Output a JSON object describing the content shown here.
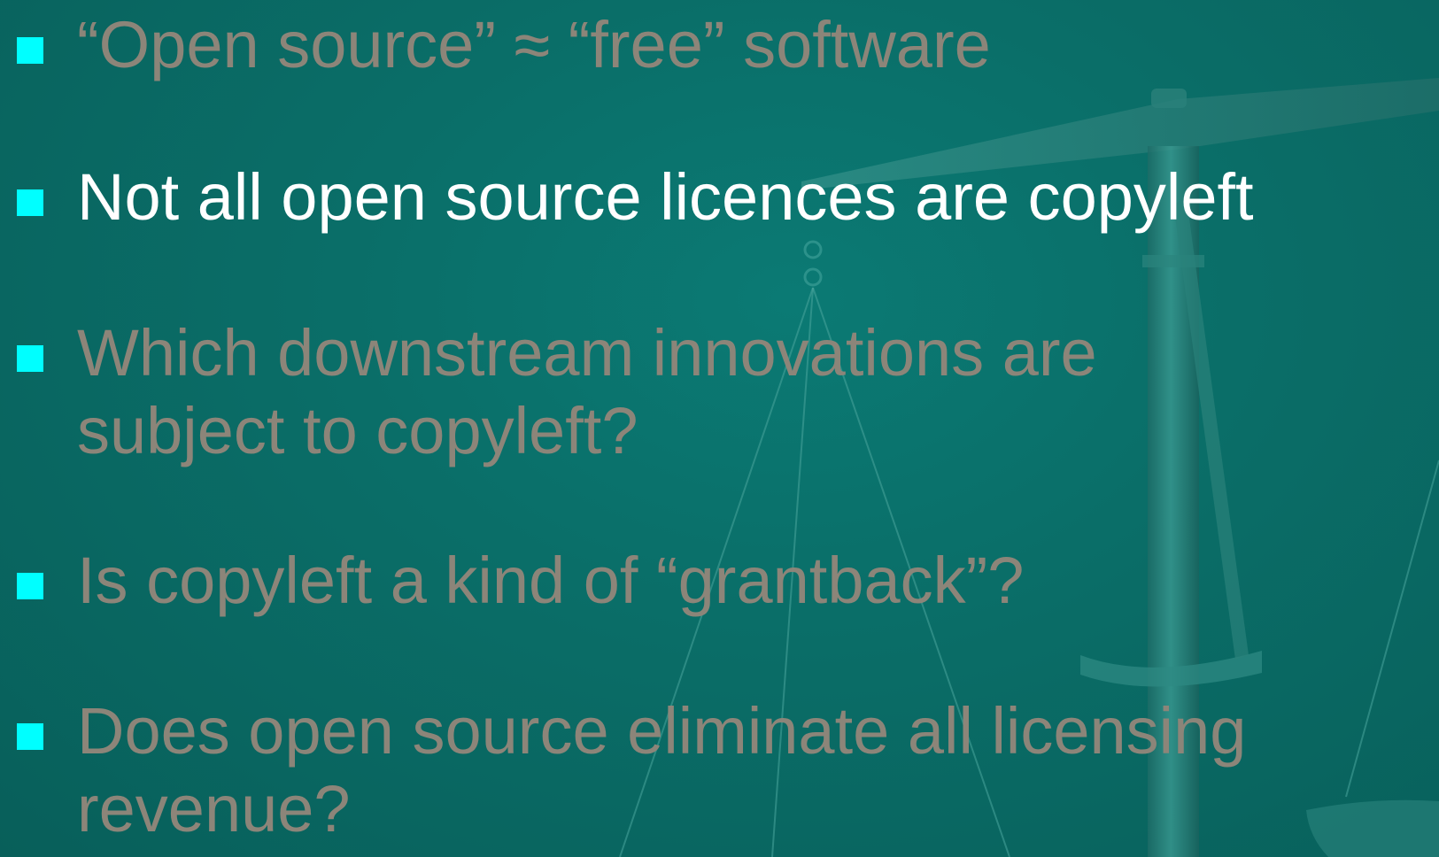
{
  "slide": {
    "bullets": [
      {
        "lines": [
          "“Open source” ≈ “free” software"
        ],
        "state": "dimmed"
      },
      {
        "lines": [
          "Not all open source licences are copyleft"
        ],
        "state": "active"
      },
      {
        "lines": [
          "Which downstream innovations are",
          "subject to copyleft?"
        ],
        "state": "dimmed"
      },
      {
        "lines": [
          "Is copyleft a kind of “grantback”?"
        ],
        "state": "dimmed"
      },
      {
        "lines": [
          "Does open source eliminate all licensing",
          "revenue?"
        ],
        "state": "dimmed"
      }
    ]
  },
  "background_icon": "scales-of-justice-icon",
  "colors": {
    "bullet_marker": "#00ffff",
    "active_text": "#ffffff",
    "dimmed_text": "#8c8579",
    "background": "#0a6e68"
  }
}
